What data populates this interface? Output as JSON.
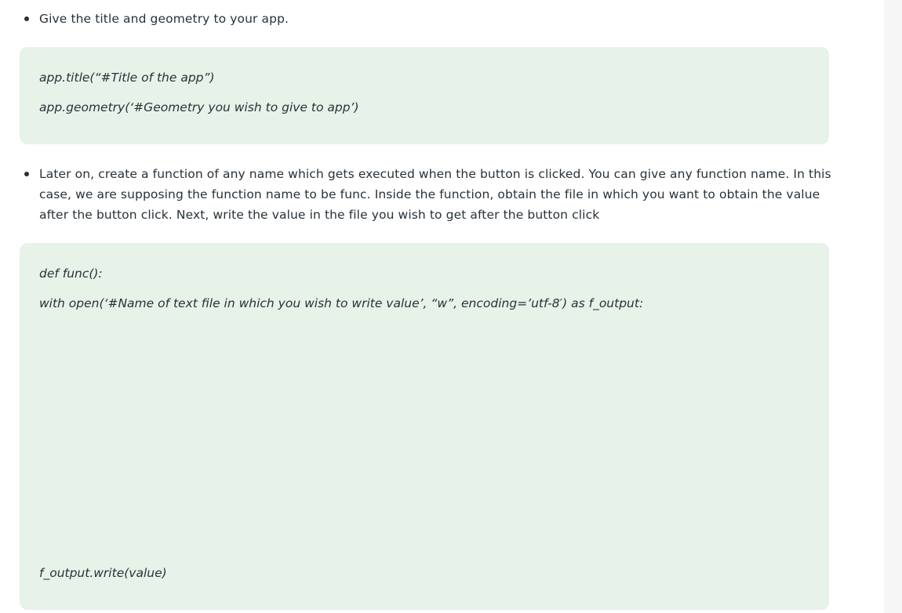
{
  "article": {
    "bullet1": "Give the title and geometry to your app.",
    "code1": {
      "line1": "app.title(“#Title of the app”)",
      "line2": "app.geometry(‘#Geometry you wish to give to app’)"
    },
    "bullet2": "Later on, create a function of any name which gets executed when the button is clicked. You can give any function name. In this case, we are supposing the function name to be func. Inside the function, obtain the file in which you want to obtain the value after the button click. Next, write the value in the file you wish to get after the button click",
    "code2": {
      "line1": "def func():",
      "line2": "with open(‘#Name of text file in which you wish to write value’, “w”, encoding=’utf-8′) as f_output:",
      "line3": "f_output.write(value)"
    }
  }
}
